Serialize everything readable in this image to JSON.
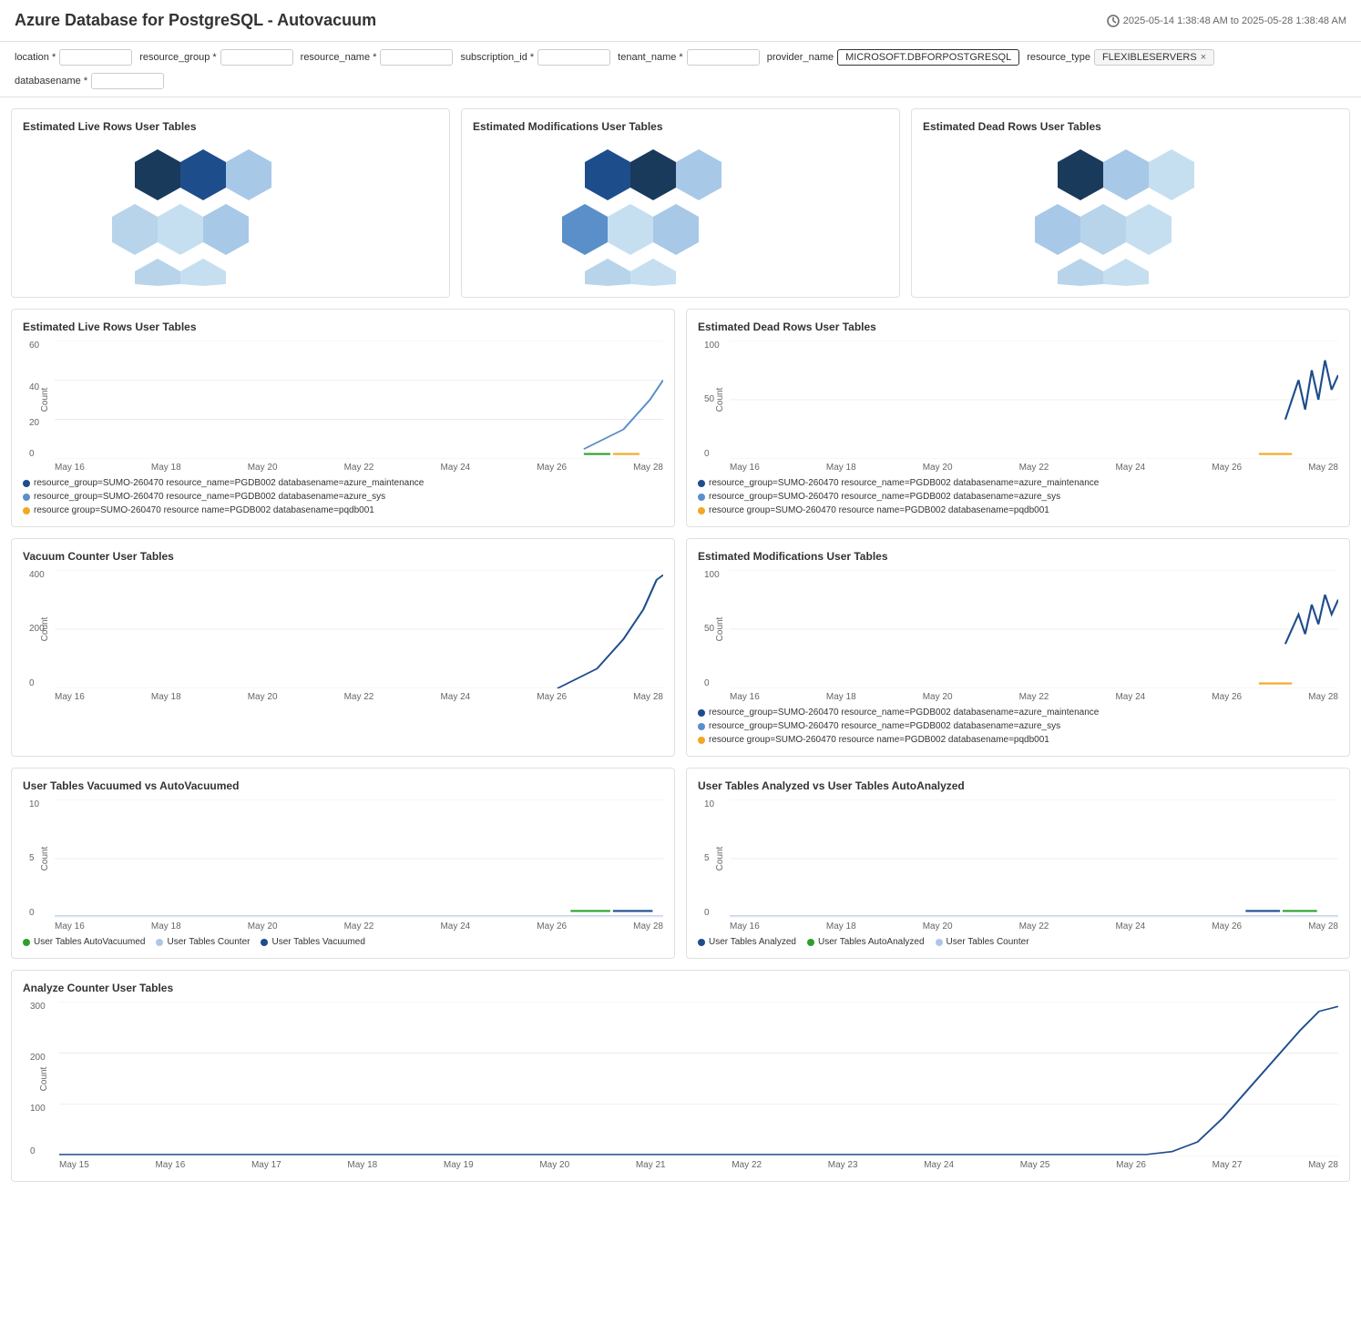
{
  "header": {
    "title": "Azure Database for PostgreSQL - Autovacuum",
    "time_range": "2025-05-14 1:38:48 AM to 2025-05-28 1:38:48 AM"
  },
  "filters": {
    "location_label": "location *",
    "resource_group_label": "resource_group *",
    "resource_name_label": "resource_name *",
    "subscription_id_label": "subscription_id *",
    "tenant_name_label": "tenant_name *",
    "provider_name_label": "provider_name",
    "provider_name_value": "MICROSOFT.DBFORPOSTGRESQL",
    "resource_type_label": "resource_type",
    "resource_type_value": "FLEXIBLESERVERS",
    "databasename_label": "databasename *"
  },
  "panels": {
    "hex1_title": "Estimated Live Rows User Tables",
    "hex2_title": "Estimated Modifications User Tables",
    "hex3_title": "Estimated Dead Rows User Tables",
    "chart1_title": "Estimated Live Rows User Tables",
    "chart2_title": "Estimated Dead Rows User Tables",
    "chart3_title": "Vacuum Counter User Tables",
    "chart4_title": "Estimated Modifications User Tables",
    "chart5_title": "User Tables Vacuumed vs AutoVacuumed",
    "chart6_title": "User Tables Analyzed vs User Tables AutoAnalyzed",
    "chart7_title": "Analyze Counter User Tables"
  },
  "chart1": {
    "y_max": "60",
    "y_mid": "40",
    "y_low": "20",
    "y_min": "0",
    "x_labels": [
      "May 16",
      "May 18",
      "May 20",
      "May 22",
      "May 24",
      "May 26",
      "May 28"
    ],
    "legend": [
      {
        "color": "#1e4d8c",
        "text": "resource_group=SUMO-260470 resource_name=PGDB002 databasename=azure_maintenance"
      },
      {
        "color": "#5b8fc9",
        "text": "resource_group=SUMO-260470 resource_name=PGDB002 databasename=azure_sys"
      },
      {
        "color": "#f5a623",
        "text": "resource  group=SUMO-260470 resource  name=PGDB002 databasename=pqdb001"
      }
    ]
  },
  "chart2": {
    "y_max": "100",
    "y_mid": "50",
    "y_min": "0",
    "x_labels": [
      "May 16",
      "May 18",
      "May 20",
      "May 22",
      "May 24",
      "May 26",
      "May 28"
    ],
    "legend": [
      {
        "color": "#1e4d8c",
        "text": "resource_group=SUMO-260470 resource_name=PGDB002 databasename=azure_maintenance"
      },
      {
        "color": "#5b8fc9",
        "text": "resource_group=SUMO-260470 resource_name=PGDB002 databasename=azure_sys"
      },
      {
        "color": "#f5a623",
        "text": "resource  group=SUMO-260470 resource  name=PGDB002 databasename=pqdb001"
      }
    ]
  },
  "chart3": {
    "y_max": "400",
    "y_mid": "200",
    "y_min": "0",
    "x_labels": [
      "May 16",
      "May 18",
      "May 20",
      "May 22",
      "May 24",
      "May 26",
      "May 28"
    ]
  },
  "chart4": {
    "y_max": "100",
    "y_mid": "50",
    "y_min": "0",
    "x_labels": [
      "May 16",
      "May 18",
      "May 20",
      "May 22",
      "May 24",
      "May 26",
      "May 28"
    ],
    "legend": [
      {
        "color": "#1e4d8c",
        "text": "resource_group=SUMO-260470 resource_name=PGDB002 databasename=azure_maintenance"
      },
      {
        "color": "#5b8fc9",
        "text": "resource_group=SUMO-260470 resource_name=PGDB002 databasename=azure_sys"
      },
      {
        "color": "#f5a623",
        "text": "resource  group=SUMO-260470 resource  name=PGDB002 databasename=pqdb001"
      }
    ]
  },
  "chart5": {
    "y_max": "10",
    "y_mid": "5",
    "y_min": "0",
    "x_labels": [
      "May 16",
      "May 18",
      "May 20",
      "May 22",
      "May 24",
      "May 26",
      "May 28"
    ],
    "legend": [
      {
        "color": "#2ca02c",
        "text": "User Tables AutoVacuumed"
      },
      {
        "color": "#aec7e8",
        "text": "User Tables Counter"
      },
      {
        "color": "#1e4d8c",
        "text": "User Tables Vacuumed"
      }
    ]
  },
  "chart6": {
    "y_max": "10",
    "y_mid": "5",
    "y_min": "0",
    "x_labels": [
      "May 16",
      "May 18",
      "May 20",
      "May 22",
      "May 24",
      "May 26",
      "May 28"
    ],
    "legend": [
      {
        "color": "#1e4d8c",
        "text": "User Tables Analyzed"
      },
      {
        "color": "#2ca02c",
        "text": "User Tables AutoAnalyzed"
      },
      {
        "color": "#aec7e8",
        "text": "User Tables Counter"
      }
    ]
  },
  "chart7": {
    "y_max": "300",
    "y_mid1": "200",
    "y_mid2": "100",
    "y_min": "0",
    "x_labels": [
      "May 15",
      "May 16",
      "May 17",
      "May 18",
      "May 19",
      "May 20",
      "May 21",
      "May 22",
      "May 23",
      "May 24",
      "May 25",
      "May 26",
      "May 27",
      "May 28"
    ]
  }
}
